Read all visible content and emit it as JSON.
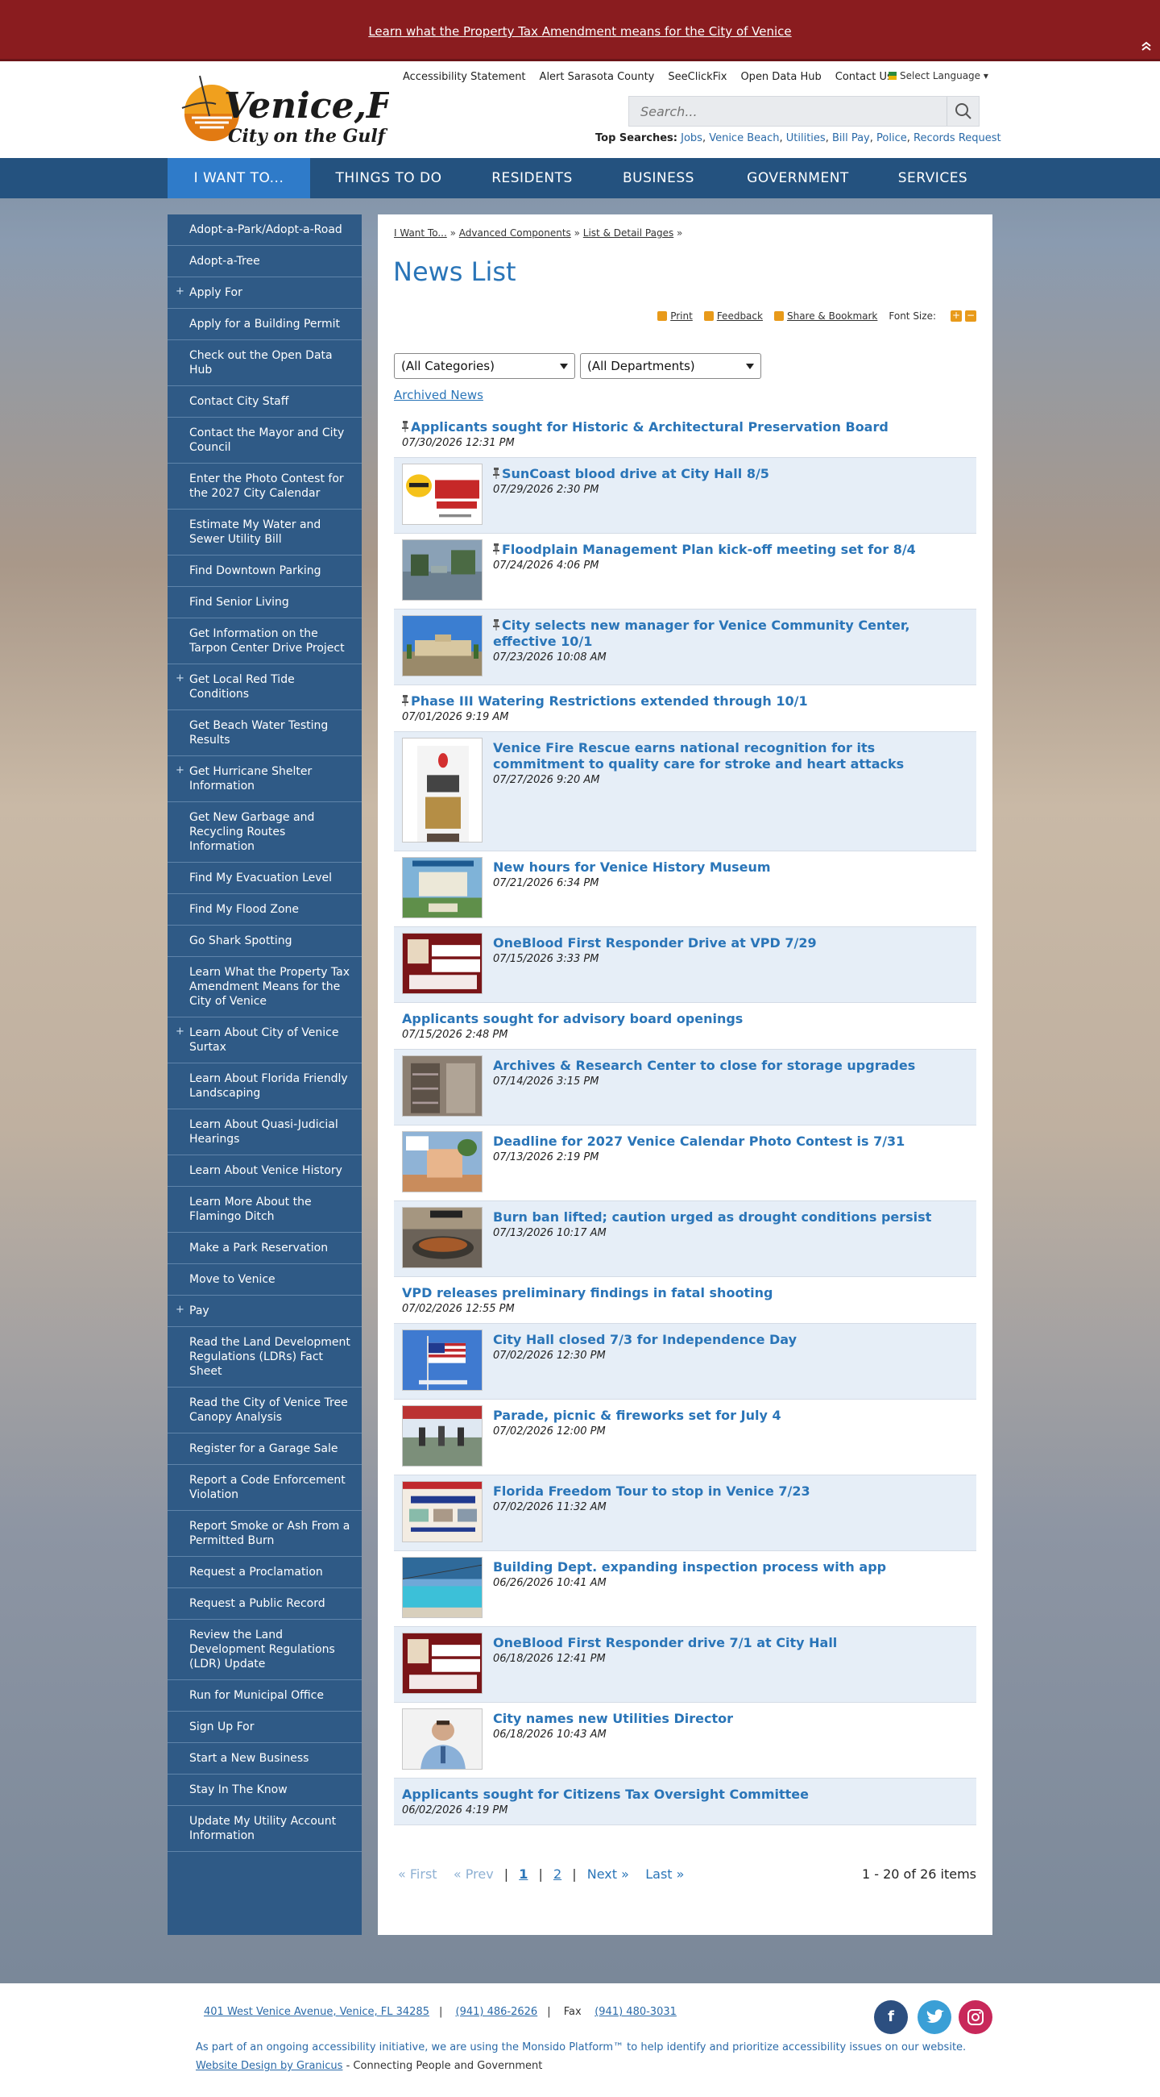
{
  "alert": {
    "text": "Learn what the Property Tax Amendment means for the City of Venice"
  },
  "header": {
    "logo_text": "Venice,FL",
    "logo_subtext": "City on the Gulf",
    "utility_links": [
      "Accessibility Statement",
      "Alert Sarasota County",
      "SeeClickFix",
      "Open Data Hub",
      "Contact Us"
    ],
    "language_label": "Select Language",
    "search_placeholder": "Search...",
    "top_searches_label": "Top Searches:",
    "top_searches": [
      "Jobs",
      "Venice Beach",
      "Utilities",
      "Bill Pay",
      "Police",
      "Records Request"
    ]
  },
  "nav": [
    "I WANT TO...",
    "THINGS TO DO",
    "RESIDENTS",
    "BUSINESS",
    "GOVERNMENT",
    "SERVICES"
  ],
  "sidebar": [
    {
      "label": "Adopt-a-Park/Adopt-a-Road",
      "plus": false
    },
    {
      "label": "Adopt-a-Tree",
      "plus": false
    },
    {
      "label": "Apply For",
      "plus": true
    },
    {
      "label": "Apply for a Building Permit",
      "plus": false
    },
    {
      "label": "Check out the Open Data Hub",
      "plus": false
    },
    {
      "label": "Contact City Staff",
      "plus": false
    },
    {
      "label": "Contact the Mayor and City Council",
      "plus": false
    },
    {
      "label": "Enter the Photo Contest for the 2027 City Calendar",
      "plus": false
    },
    {
      "label": "Estimate My Water and Sewer Utility Bill",
      "plus": false
    },
    {
      "label": "Find Downtown Parking",
      "plus": false
    },
    {
      "label": "Find Senior Living",
      "plus": false
    },
    {
      "label": "Get Information on the Tarpon Center Drive Project",
      "plus": false
    },
    {
      "label": "Get Local Red Tide Conditions",
      "plus": true
    },
    {
      "label": "Get Beach Water Testing Results",
      "plus": false
    },
    {
      "label": "Get Hurricane Shelter Information",
      "plus": true
    },
    {
      "label": "Get New Garbage and Recycling Routes Information",
      "plus": false
    },
    {
      "label": "Find My Evacuation Level",
      "plus": false
    },
    {
      "label": "Find My Flood Zone",
      "plus": false
    },
    {
      "label": "Go Shark Spotting",
      "plus": false
    },
    {
      "label": "Learn What the Property Tax Amendment Means for the City of Venice",
      "plus": false
    },
    {
      "label": "Learn About City of Venice Surtax",
      "plus": true
    },
    {
      "label": "Learn About Florida Friendly Landscaping",
      "plus": false
    },
    {
      "label": "Learn About Quasi-Judicial Hearings",
      "plus": false
    },
    {
      "label": "Learn About Venice History",
      "plus": false
    },
    {
      "label": "Learn More About the Flamingo Ditch",
      "plus": false
    },
    {
      "label": "Make a Park Reservation",
      "plus": false
    },
    {
      "label": "Move to Venice",
      "plus": false
    },
    {
      "label": "Pay",
      "plus": true
    },
    {
      "label": "Read the Land Development Regulations (LDRs) Fact Sheet",
      "plus": false
    },
    {
      "label": "Read the City of Venice Tree Canopy Analysis",
      "plus": false
    },
    {
      "label": "Register for a Garage Sale",
      "plus": false
    },
    {
      "label": "Report a Code Enforcement Violation",
      "plus": false
    },
    {
      "label": "Report Smoke or Ash From a Permitted Burn",
      "plus": false
    },
    {
      "label": "Request a Proclamation",
      "plus": false
    },
    {
      "label": "Request a Public Record",
      "plus": false
    },
    {
      "label": "Review the Land Development Regulations (LDR) Update",
      "plus": false
    },
    {
      "label": "Run for Municipal Office",
      "plus": false
    },
    {
      "label": "Sign Up For",
      "plus": false
    },
    {
      "label": "Start a New Business",
      "plus": false
    },
    {
      "label": "Stay In The Know",
      "plus": false
    },
    {
      "label": "Update My Utility Account Information",
      "plus": false
    }
  ],
  "content": {
    "breadcrumb": [
      "I Want To...",
      "Advanced Components",
      "List & Detail Pages"
    ],
    "title": "News List",
    "tools": {
      "print": "Print",
      "feedback": "Feedback",
      "share": "Share & Bookmark",
      "font_size": "Font Size:"
    },
    "categories_select": "(All Categories)",
    "departments_select": "(All Departments)",
    "archived": "Archived News",
    "items": [
      {
        "title": "Applicants sought for Historic & Architectural Preservation Board",
        "date": "07/30/2026 12:31 PM",
        "pinned": true,
        "thumb": null
      },
      {
        "title": "SunCoast blood drive at City Hall 8/5",
        "date": "07/29/2026 2:30 PM",
        "pinned": true,
        "thumb": "blood-drive"
      },
      {
        "title": "Floodplain Management Plan kick-off meeting set for 8/4",
        "date": "07/24/2026 4:06 PM",
        "pinned": true,
        "thumb": "flood"
      },
      {
        "title": "City selects new manager for Venice Community Center, effective 10/1",
        "date": "07/23/2026 10:08 AM",
        "pinned": true,
        "thumb": "community-center"
      },
      {
        "title": "Phase III Watering Restrictions extended through 10/1",
        "date": "07/01/2026 9:19 AM",
        "pinned": true,
        "thumb": null
      },
      {
        "title": "Venice Fire Rescue earns national recognition for its commitment to quality care for stroke and heart attacks",
        "date": "07/27/2026 9:20 AM",
        "pinned": false,
        "thumb": "ems-award"
      },
      {
        "title": "New hours for Venice History Museum",
        "date": "07/21/2026 6:34 PM",
        "pinned": false,
        "thumb": "museum"
      },
      {
        "title": "OneBlood First Responder Drive at VPD 7/29",
        "date": "07/15/2026 3:33 PM",
        "pinned": false,
        "thumb": "donate-blood"
      },
      {
        "title": "Applicants sought for advisory board openings",
        "date": "07/15/2026 2:48 PM",
        "pinned": false,
        "thumb": null
      },
      {
        "title": "Archives & Research Center to close for storage upgrades",
        "date": "07/14/2026 3:15 PM",
        "pinned": false,
        "thumb": "archives"
      },
      {
        "title": "Deadline for 2027 Venice Calendar Photo Contest is 7/31",
        "date": "07/13/2026 2:19 PM",
        "pinned": false,
        "thumb": "calendar-contest"
      },
      {
        "title": "Burn ban lifted; caution urged as drought conditions persist",
        "date": "07/13/2026 10:17 AM",
        "pinned": false,
        "thumb": "burn-ban"
      },
      {
        "title": "VPD releases preliminary findings in fatal shooting",
        "date": "07/02/2026 12:55 PM",
        "pinned": false,
        "thumb": null
      },
      {
        "title": "City Hall closed 7/3 for Independence Day",
        "date": "07/02/2026 12:30 PM",
        "pinned": false,
        "thumb": "flag"
      },
      {
        "title": "Parade, picnic & fireworks set for July 4",
        "date": "07/02/2026 12:00 PM",
        "pinned": false,
        "thumb": "parade"
      },
      {
        "title": "Florida Freedom Tour to stop in Venice 7/23",
        "date": "07/02/2026 11:32 AM",
        "pinned": false,
        "thumb": "freedom-tour"
      },
      {
        "title": "Building Dept. expanding inspection process with app",
        "date": "06/26/2026 10:41 AM",
        "pinned": false,
        "thumb": "pool"
      },
      {
        "title": "OneBlood First Responder drive 7/1 at City Hall",
        "date": "06/18/2026 12:41 PM",
        "pinned": false,
        "thumb": "donate-blood"
      },
      {
        "title": "City names new Utilities Director",
        "date": "06/18/2026 10:43 AM",
        "pinned": false,
        "thumb": "portrait"
      },
      {
        "title": "Applicants sought for Citizens Tax Oversight Committee",
        "date": "06/02/2026 4:19 PM",
        "pinned": false,
        "thumb": null
      }
    ],
    "pager": {
      "first": "« First",
      "prev": "« Prev",
      "page1": "1",
      "page2": "2",
      "next": "Next »",
      "last": "Last »",
      "count": "1 - 20 of 26 items"
    }
  },
  "footer": {
    "address": "401 West Venice Avenue, Venice, FL 34285",
    "phone": "(941) 486-2626",
    "fax_label": "Fax",
    "fax": "(941) 480-3031",
    "monsido": "As part of an ongoing accessibility initiative, we are using the Monsido Platform™ to help identify and prioritize accessibility issues on our website.",
    "granicus_link": "Website Design by Granicus",
    "granicus_tail": " - Connecting People and Government",
    "social": [
      "f",
      "t",
      "ig"
    ],
    "colors": {
      "facebook": "#2c4f80",
      "twitter": "#3a9fd6",
      "instagram": "#c8285a"
    }
  }
}
